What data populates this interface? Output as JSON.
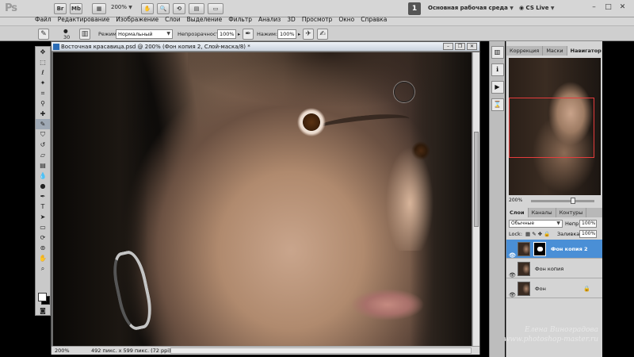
{
  "app": {
    "logo": "Ps",
    "zoom": "200%",
    "workspace_num": "1",
    "workspace": "Основная рабочая среда",
    "cslive": "CS Live",
    "buttons": [
      "Br",
      "Mb"
    ]
  },
  "menu": [
    "Файл",
    "Редактирование",
    "Изображение",
    "Слои",
    "Выделение",
    "Фильтр",
    "Анализ",
    "3D",
    "Просмотр",
    "Окно",
    "Справка"
  ],
  "options": {
    "brush_size": "30",
    "mode_label": "Режим:",
    "mode_value": "Нормальный",
    "opacity_label": "Непрозрачность:",
    "opacity_value": "100%",
    "pressure_label": "Нажим:",
    "pressure_value": "100%"
  },
  "document": {
    "title": "Восточная красавица.psd @ 200% (Фон копия 2, Слой-маска/8) *",
    "status_zoom": "200%",
    "status_info": "492 пикс. x 599 пикс. (72 ppi)"
  },
  "panels": {
    "top_tabs": [
      "Коррекция",
      "Маски",
      "Навигатор"
    ],
    "nav_zoom": "200%",
    "layer_tabs": [
      "Слои",
      "Каналы",
      "Контуры"
    ],
    "blend_mode": "Обычные",
    "opacity_label": "Непр",
    "opacity_value": "100%",
    "lock_label": "Lock:",
    "fill_label": "Заливка:",
    "fill_value": "100%",
    "layers": [
      {
        "name": "Фон копия 2",
        "selected": true,
        "has_mask": true
      },
      {
        "name": "Фон копия",
        "selected": false,
        "has_mask": false
      },
      {
        "name": "Фон",
        "selected": false,
        "has_mask": false,
        "locked": true
      }
    ]
  },
  "watermark": {
    "line1": "Елена Виноградова",
    "line2": "www.photoshop-master.ru"
  },
  "colors": {
    "selection": "#4a8fd6",
    "nav_rect": "#e53c3c"
  }
}
